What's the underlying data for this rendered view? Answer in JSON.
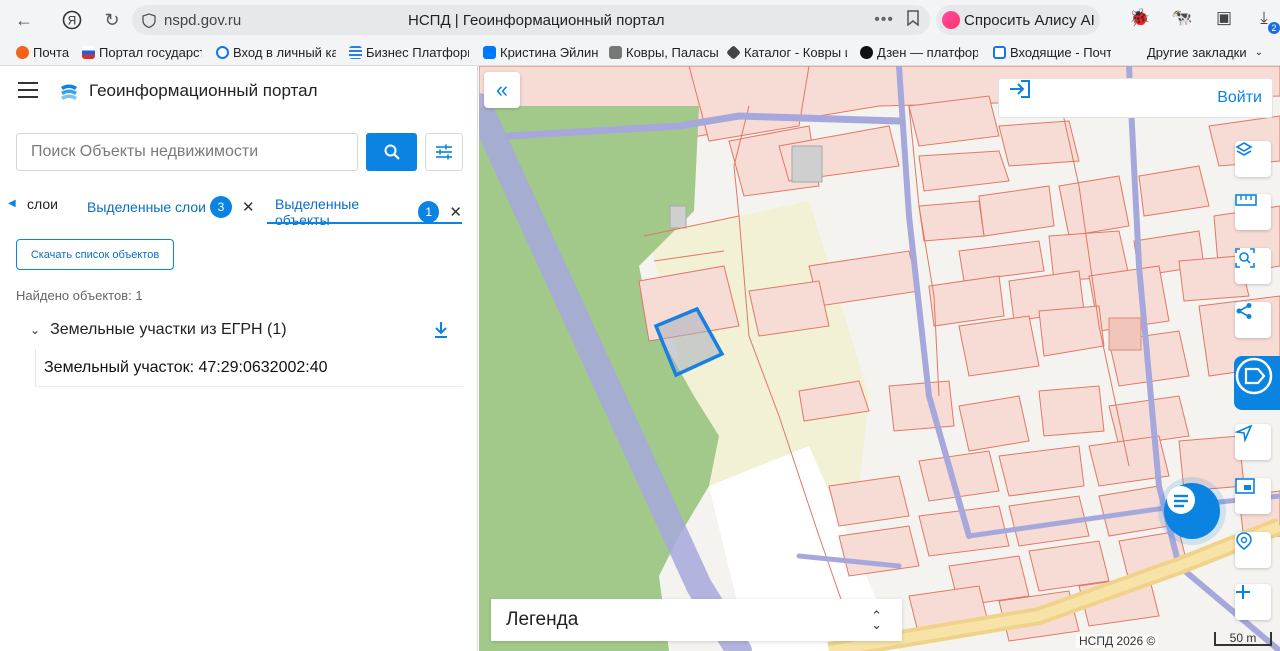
{
  "browser": {
    "url": "nspd.gov.ru",
    "page_title": "НСПД | Геоинформационный портал",
    "alice_label": "Спросить Алису AI",
    "downloads_count": "2",
    "bookmarks": [
      {
        "label": "Почта",
        "color": "#f5631b"
      },
      {
        "label": "Портал государст",
        "color": "#d5322f"
      },
      {
        "label": "Вход в личный ка",
        "color": "#1a73e8"
      },
      {
        "label": "Бизнес Платформ",
        "color": "#2a7de1"
      },
      {
        "label": "Кристина Эйлин",
        "color": "#0077ff"
      },
      {
        "label": "Ковры, Паласы",
        "color": "#555555"
      },
      {
        "label": "Каталог - Ковры и",
        "color": "#444444"
      },
      {
        "label": "Дзен — платформ",
        "color": "#111111"
      },
      {
        "label": "Входящие - Почта",
        "color": "#1a73e8"
      }
    ],
    "other_bookmarks": "Другие закладки"
  },
  "sidebar": {
    "app_title": "Геоинформационный портал",
    "search_placeholder": "Поиск Объекты недвижимости",
    "tabs": [
      {
        "label": "слои"
      },
      {
        "label": "Выделенные слои",
        "badge": "3"
      },
      {
        "label": "Выделенные объекты",
        "badge": "1"
      }
    ],
    "download_button": "Скачать список объектов",
    "found_text": "Найдено объектов: 1",
    "group_title": "Земельные участки из ЕГРН (1)",
    "item_text": "Земельный участок: 47:29:0632002:40"
  },
  "map": {
    "login_label": "Войти",
    "legend_label": "Легенда",
    "attribution": "НСПД 2026 ©",
    "scale_label": "50 m",
    "colors": {
      "forest": "#a3c98a",
      "parcel_fill": "#f7dbd5",
      "parcel_stroke": "#e07865",
      "road": "#a6a8dc",
      "selection": "#1a7fe0",
      "accent": "#0a84e0"
    }
  }
}
